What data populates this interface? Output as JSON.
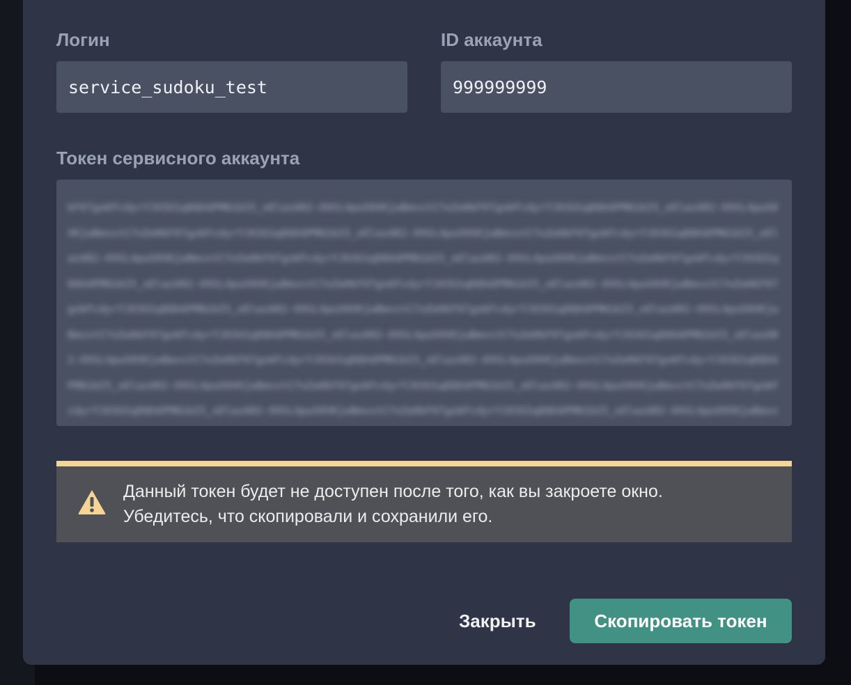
{
  "dialog": {
    "login_label": "Логин",
    "login_value": "service_sudoku_test",
    "account_id_label": "ID аккаунта",
    "account_id_value": "999999999",
    "token_label": "Токен сервисного аккаунта",
    "warning": {
      "line1": "Данный токен будет не доступен после того, как вы закроете окно.",
      "line2": "Убедитесь, что скопировали и сохранили его.",
      "icon": "warning-triangle-icon",
      "accent_color": "#f5d495"
    },
    "close_label": "Закрыть",
    "copy_label": "Скопировать токен",
    "copy_color": "#419184"
  }
}
